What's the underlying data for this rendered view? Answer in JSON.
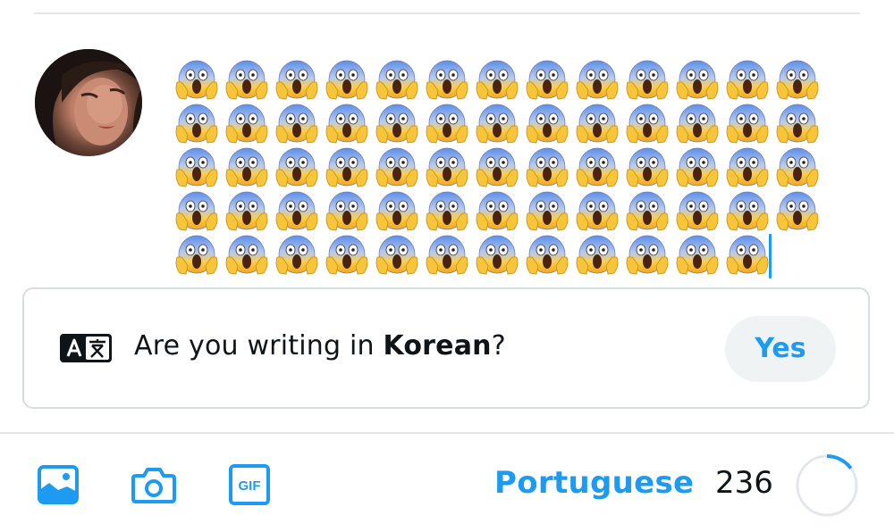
{
  "composer": {
    "emoji_char": "😱",
    "emoji_name": "face-screaming-in-fear",
    "rows": [
      13,
      13,
      13,
      13,
      12
    ]
  },
  "language_prompt": {
    "icon": "translate-icon",
    "text_before": "Are you writing in ",
    "language": "Korean",
    "text_after": "?",
    "yes_label": "Yes"
  },
  "toolbar": {
    "icons": [
      "image-icon",
      "camera-icon",
      "gif-icon"
    ],
    "gif_label": "GIF",
    "language_label": "Portuguese",
    "remaining_count": "236",
    "progress_fraction": 0.15
  },
  "colors": {
    "accent": "#1d9bf0",
    "text": "#0f1419",
    "pill_bg": "#eff3f4",
    "border": "#d8dde1"
  }
}
